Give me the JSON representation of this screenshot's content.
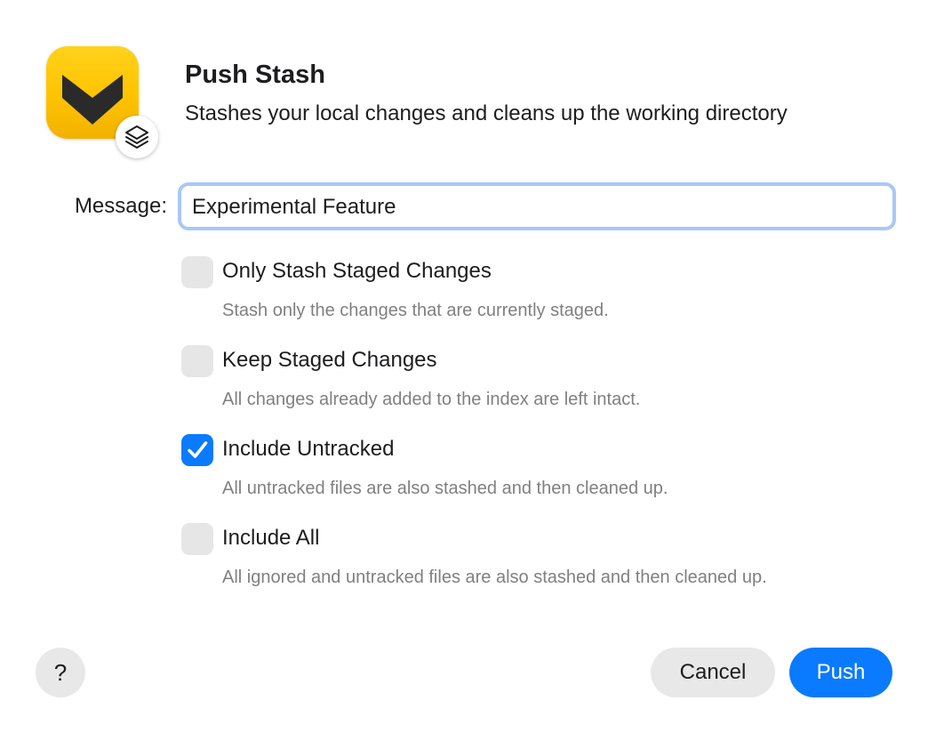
{
  "dialog": {
    "title": "Push Stash",
    "subtitle": "Stashes your local changes and cleans up the working directory",
    "app_icon": "app-logo-icon",
    "badge_icon": "layers-icon"
  },
  "message": {
    "label": "Message:",
    "value": "Experimental Feature"
  },
  "options": [
    {
      "label": "Only Stash Staged Changes",
      "description": "Stash only the changes that are currently staged.",
      "checked": false
    },
    {
      "label": "Keep Staged Changes",
      "description": "All changes already added to the index are left intact.",
      "checked": false
    },
    {
      "label": "Include Untracked",
      "description": "All untracked files are also stashed and then cleaned up.",
      "checked": true
    },
    {
      "label": "Include All",
      "description": "All ignored and untracked files are also stashed and then cleaned up.",
      "checked": false
    }
  ],
  "footer": {
    "help_label": "?",
    "cancel_label": "Cancel",
    "push_label": "Push"
  },
  "colors": {
    "accent": "#0a7aff",
    "icon_yellow": "#ffc300",
    "focus_ring": "#a8c8f8"
  }
}
